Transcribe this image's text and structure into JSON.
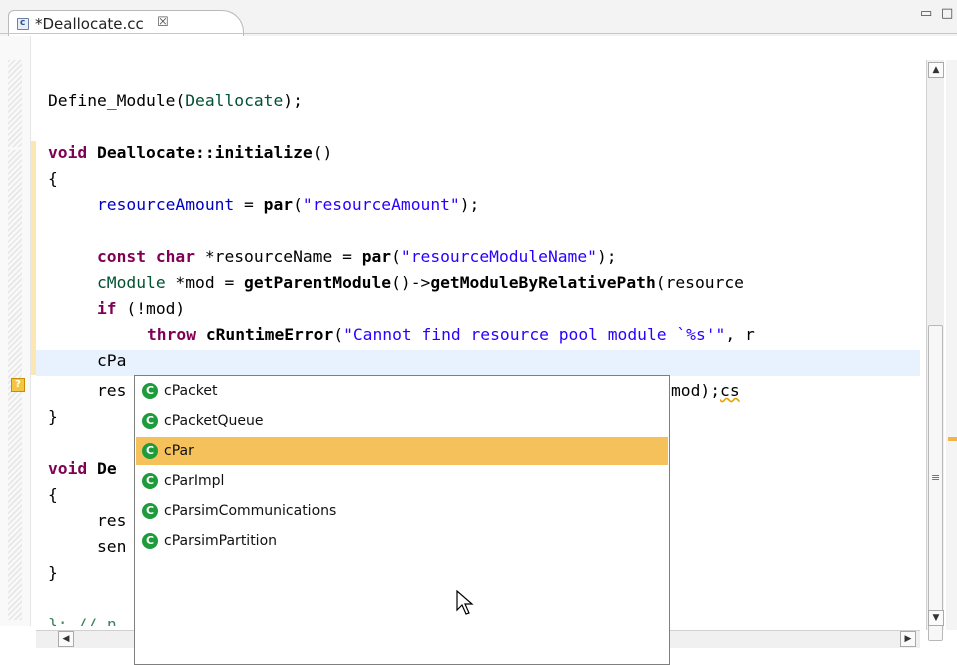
{
  "tab": {
    "title": "*Deallocate.cc",
    "close": "☒",
    "icon": "c"
  },
  "window_controls": {
    "minimize": "▭",
    "maximize": "□"
  },
  "code": {
    "l1_func": "Define_Module",
    "l1_open": "(",
    "l1_arg": "Deallocate",
    "l1_close": ");",
    "l2_kw": "void",
    "l2_name": "Deallocate::initialize",
    "l2_rest": "()",
    "l3": "{",
    "l4_field": "resourceAmount",
    "l4_eq": " = ",
    "l4_fn": "par",
    "l4_open": "(",
    "l4_str": "\"resourceAmount\"",
    "l4_close": ");",
    "l5_kw1": "const",
    "l5_kw2": "char",
    "l5_var": " *resourceName = ",
    "l5_fn": "par",
    "l5_open": "(",
    "l5_str": "\"resourceModuleName\"",
    "l5_close": ");",
    "l6_type": "cModule",
    "l6_var": " *mod = ",
    "l6_fn": "getParentModule",
    "l6_arrow": "()->",
    "l6_fn2": "getModuleByRelativePath",
    "l6_rest": "(resource",
    "l7_kw": "if",
    "l7_rest": " (!mod)",
    "l8_kw": "throw",
    "l8_fn": "cRuntimeError",
    "l8_open": "(",
    "l8_str": "\"Cannot find resource pool module `%s'\"",
    "l8_rest": ", r",
    "l9": "cPa",
    "l10_left": "res",
    "l10_right": "mod);",
    "l10_squig": "cs",
    "l11": "}",
    "l12_kw": "void",
    "l12_rest": "De",
    "l13": "{",
    "l14": "res",
    "l15": "sen",
    "l16": "}",
    "l17": "}; // n"
  },
  "completion": {
    "items": [
      {
        "label": "cPacket",
        "selected": false
      },
      {
        "label": "cPacketQueue",
        "selected": false
      },
      {
        "label": "cPar",
        "selected": true
      },
      {
        "label": "cParImpl",
        "selected": false
      },
      {
        "label": "cParsimCommunications",
        "selected": false
      },
      {
        "label": "cParsimPartition",
        "selected": false
      }
    ],
    "icon": "class-icon"
  },
  "scroll": {
    "up": "▲",
    "down": "▼",
    "left": "◀",
    "right": "▶",
    "grip": "≡"
  },
  "markers": {
    "warning": "?"
  },
  "colors": {
    "keyword": "#7f0055",
    "field": "#0000c0",
    "string": "#2a00ff",
    "selection": "#f5c15a",
    "current_line": "#e8f2fe"
  }
}
